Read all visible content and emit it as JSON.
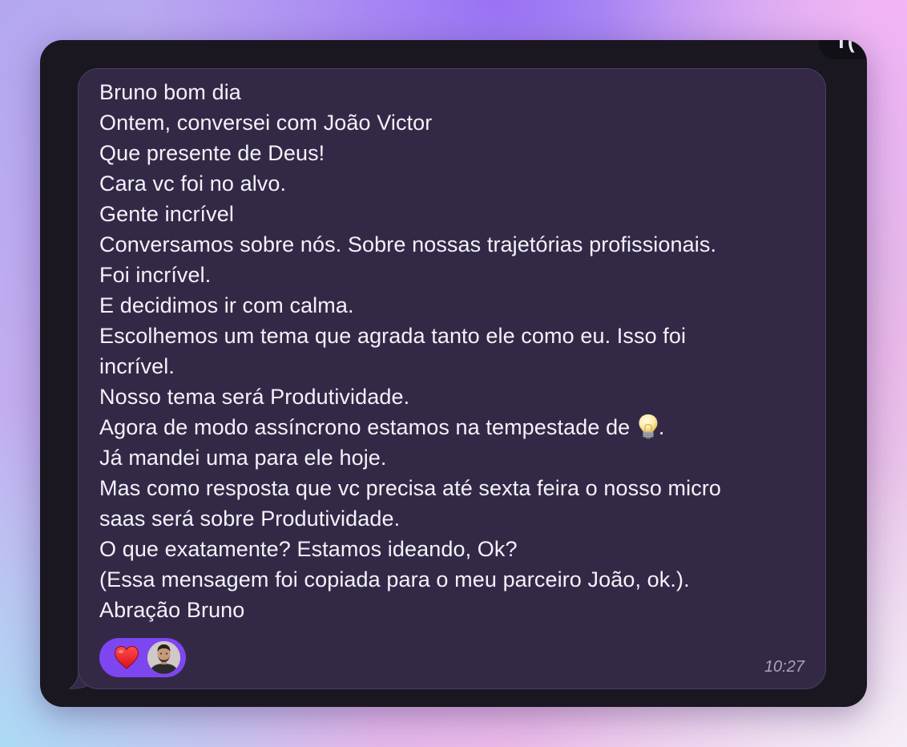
{
  "previous_message": {
    "visible_text": "T("
  },
  "message": {
    "lines": [
      "Bruno bom dia",
      "Ontem, conversei com João Victor",
      "Que presente de Deus!",
      "Cara vc foi no alvo.",
      "Gente incrível",
      "Conversamos sobre nós. Sobre nossas trajetórias profissionais.",
      "Foi incrível.",
      "E decidimos ir com calma.",
      "Escolhemos um tema que agrada tanto ele como eu. Isso foi",
      "incrível.",
      "Nosso tema será Produtividade.",
      "Agora de modo assíncrono estamos na tempestade de",
      "Já mandei uma para ele hoje.",
      "Mas como resposta que vc precisa até sexta feira o nosso micro",
      "saas será sobre Produtividade.",
      "O que exatamente? Estamos ideando, Ok?",
      "(Essa mensagem foi copiada para o meu parceiro João, ok.).",
      "Abração Bruno"
    ],
    "inline_emoji": "lightbulb-icon",
    "inline_emoji_suffix": ".",
    "time": "10:27"
  },
  "reactions": {
    "emoji": "heart-icon",
    "reactor": "avatar"
  },
  "colors": {
    "window_bg": "#1a1721",
    "bubble_bg": "#332947",
    "reaction_pill": "#7e46f0",
    "text": "#f4f2f8",
    "timestamp": "#aaa3b8"
  }
}
